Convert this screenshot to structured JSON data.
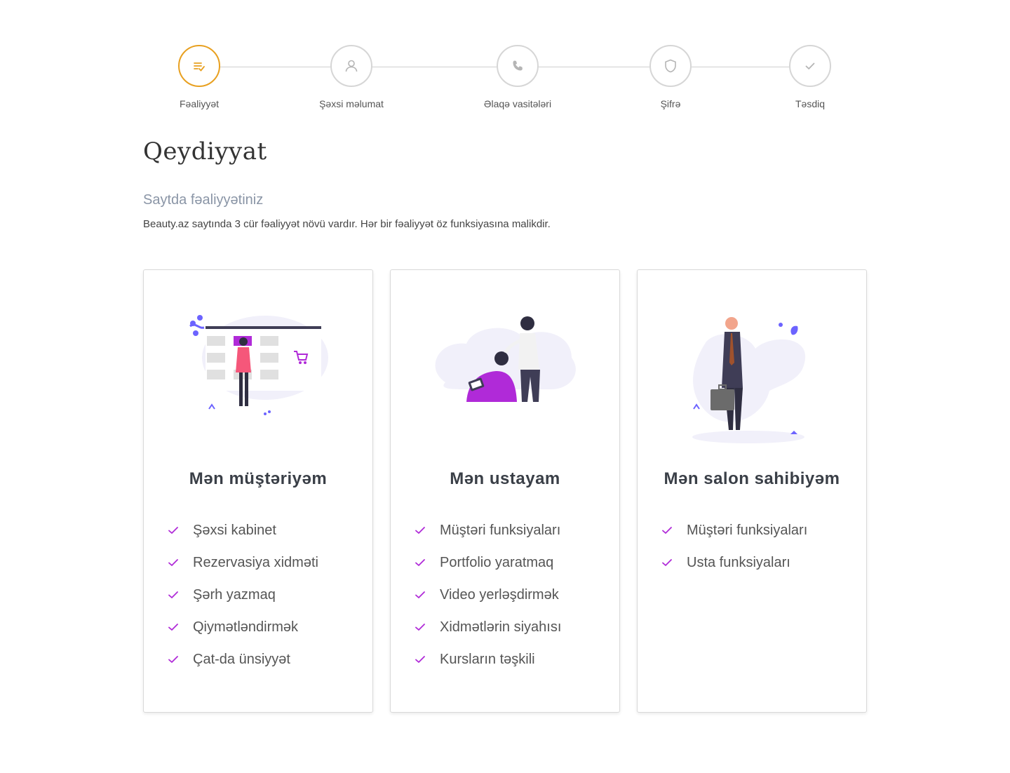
{
  "stepper": {
    "steps": [
      {
        "label": "Fəaliyyət",
        "icon": "list-check-icon",
        "active": true
      },
      {
        "label": "Şəxsi məlumat",
        "icon": "user-icon",
        "active": false
      },
      {
        "label": "Əlaqə vasitələri",
        "icon": "phone-icon",
        "active": false
      },
      {
        "label": "Şifrə",
        "icon": "shield-icon",
        "active": false
      },
      {
        "label": "Təsdiq",
        "icon": "checkmark-icon",
        "active": false
      }
    ]
  },
  "page": {
    "title": "Qeydiyyat",
    "subtitle": "Saytda fəaliyyətiniz",
    "description": "Beauty.az saytında 3 cür fəaliyyət növü vardır. Hər bir fəaliyyət öz funksiyasına malikdir."
  },
  "cards": [
    {
      "title": "Mən müştəriyəm",
      "illustration": "customer-calendar-illustration",
      "features": [
        "Şəxsi kabinet",
        "Rezervasiya xidməti",
        "Şərh yazmaq",
        "Qiymətləndirmək",
        "Çat-da ünsiyyət"
      ]
    },
    {
      "title": "Mən ustayam",
      "illustration": "barber-illustration",
      "features": [
        "Müştəri funksiyaları",
        "Portfolio yaratmaq",
        "Video yerləşdirmək",
        "Xidmətlərin siyahısı",
        "Kursların təşkili"
      ]
    },
    {
      "title": "Mən salon sahibiyəm",
      "illustration": "businessman-illustration",
      "features": [
        "Müştəri funksiyaları",
        "Usta funksiyaları"
      ]
    }
  ],
  "colors": {
    "active_step": "#e8a020",
    "accent_purple": "#b02ad8",
    "illustration_purple": "#6c63ff",
    "illustration_pink": "#f5577a",
    "text_muted": "#8a95a6"
  }
}
